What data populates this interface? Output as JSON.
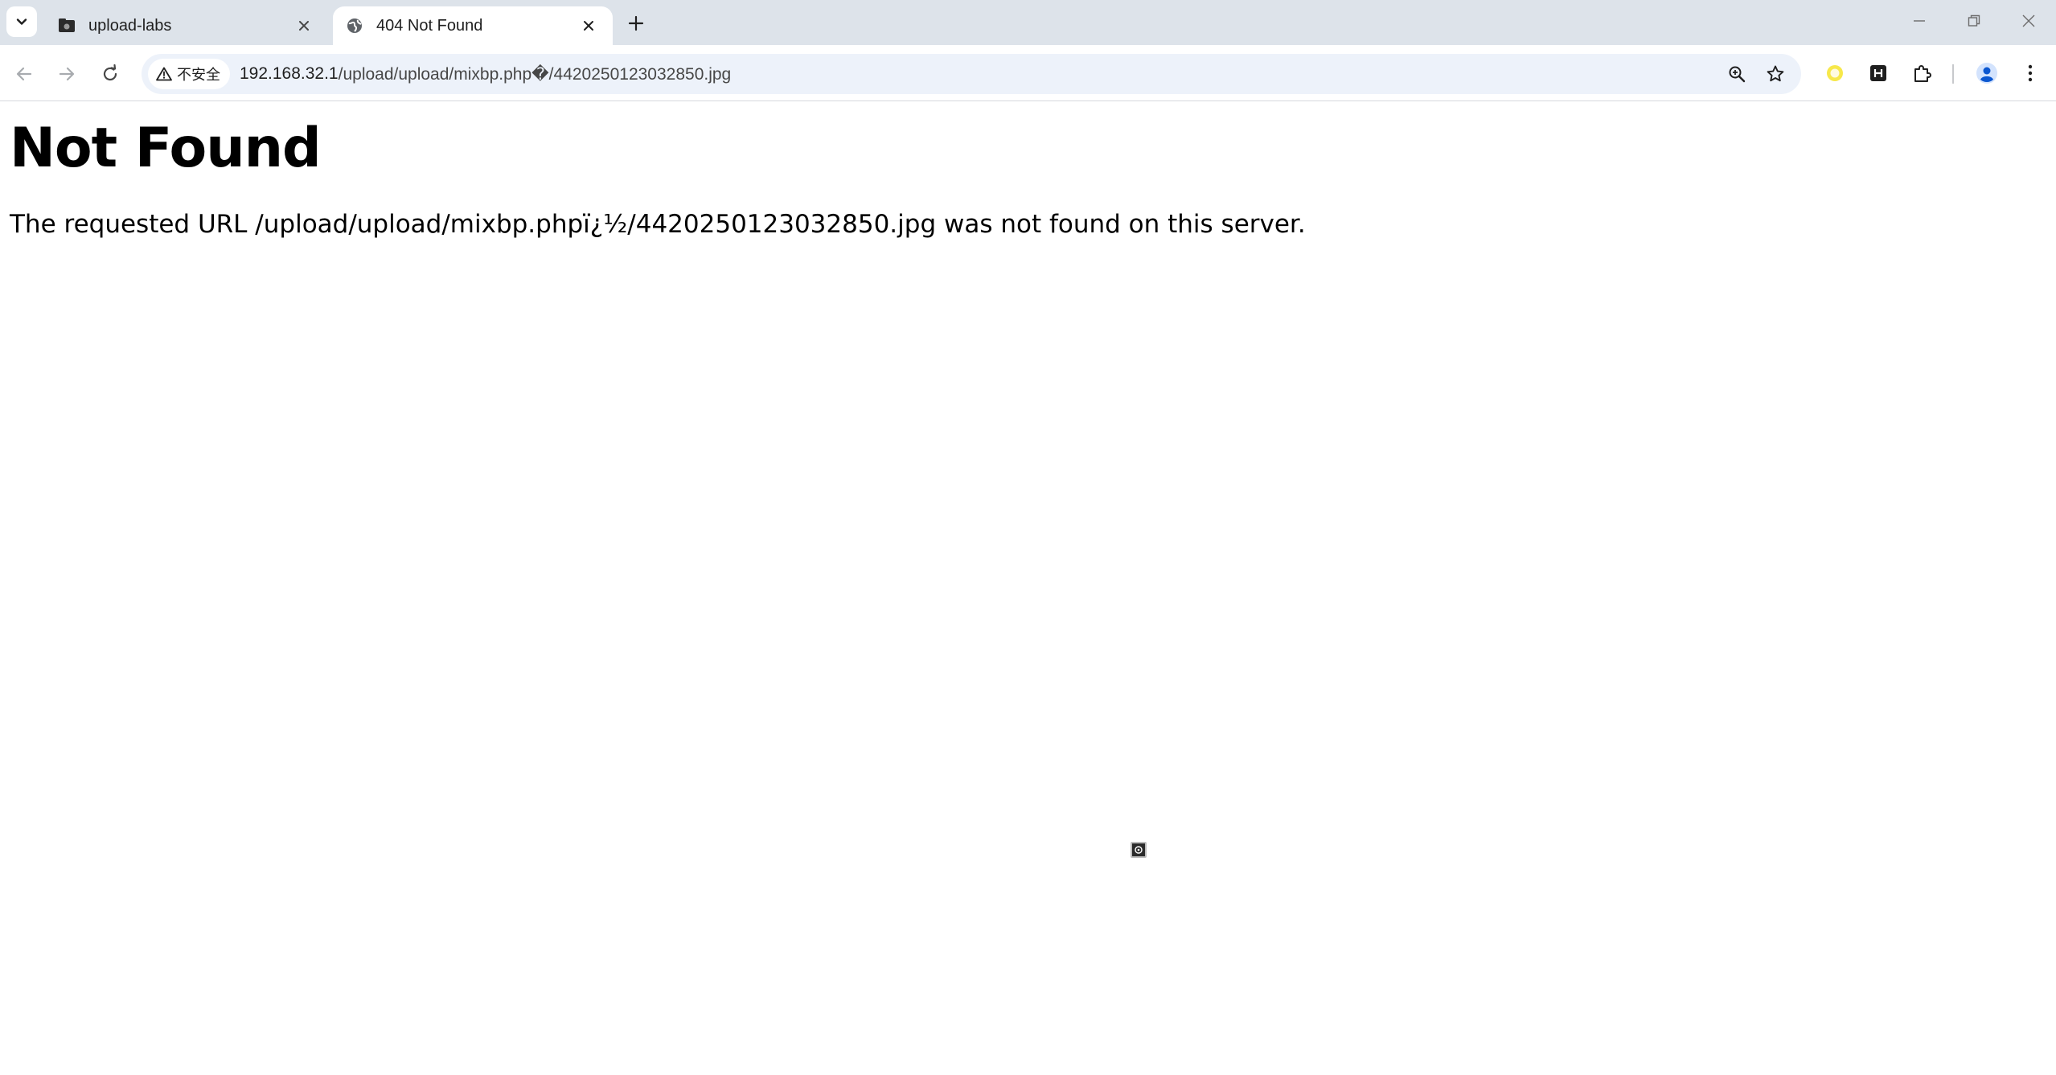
{
  "browser": {
    "tabs": [
      {
        "title": "upload-labs",
        "active": false,
        "favicon": "folder-icon"
      },
      {
        "title": "404 Not Found",
        "active": true,
        "favicon": "globe-icon"
      }
    ],
    "address_bar": {
      "security_label": "不安全",
      "url_host": "192.168.32.1",
      "url_path": "/upload/upload/mixbp.php�/4420250123032850.jpg"
    },
    "extensions": [
      "yellow-circle-extension-icon",
      "h-extension-icon",
      "puzzle-extensions-icon"
    ],
    "colors": {
      "tabstrip": "#dde3ea",
      "omnibox": "#edf2fa",
      "avatar": "#0b57d0",
      "extension_yellow": "#f7e84a"
    }
  },
  "page": {
    "heading": "Not Found",
    "message": "The requested URL /upload/upload/mixbp.phpï¿½/4420250123032850.jpg was not found on this server."
  }
}
